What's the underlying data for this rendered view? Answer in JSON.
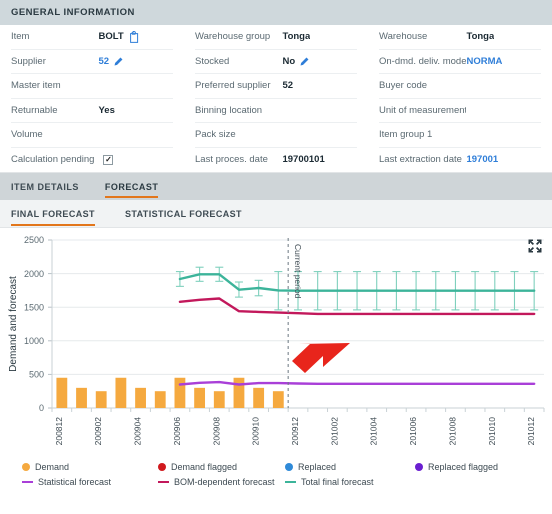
{
  "general_information": {
    "section_title": "GENERAL INFORMATION",
    "columns": [
      {
        "rows": [
          {
            "label": "Item",
            "value": "BOLT",
            "icon": "copy-icon",
            "link": false
          },
          {
            "label": "Supplier",
            "value": "52",
            "icon": "pencil-icon",
            "link": true
          },
          {
            "label": "Master item",
            "value": "",
            "icon": "",
            "link": false
          },
          {
            "label": "Returnable",
            "value": "Yes",
            "icon": "",
            "link": false
          },
          {
            "label": "Volume",
            "value": "",
            "icon": "",
            "link": false
          },
          {
            "label": "Calculation pending",
            "value": "",
            "icon": "checkbox-checked",
            "link": false
          }
        ]
      },
      {
        "rows": [
          {
            "label": "Warehouse group",
            "value": "Tonga",
            "icon": "",
            "link": false
          },
          {
            "label": "Stocked",
            "value": "No",
            "icon": "pencil-icon",
            "link": false
          },
          {
            "label": "Preferred supplier",
            "value": "52",
            "icon": "",
            "link": false
          },
          {
            "label": "Binning location",
            "value": "",
            "icon": "",
            "link": false
          },
          {
            "label": "Pack size",
            "value": "",
            "icon": "",
            "link": false
          },
          {
            "label": "Last proces. date",
            "value": "19700101",
            "icon": "",
            "link": false
          }
        ]
      },
      {
        "rows": [
          {
            "label": "Warehouse",
            "value": "Tonga",
            "icon": "",
            "link": false
          },
          {
            "label": "On-dmd. deliv. mode",
            "value": "NORMA",
            "icon": "",
            "link": true
          },
          {
            "label": "Buyer code",
            "value": "",
            "icon": "",
            "link": false
          },
          {
            "label": "Unit of measurement",
            "value": "",
            "icon": "",
            "link": false
          },
          {
            "label": "Item group 1",
            "value": "",
            "icon": "",
            "link": false
          },
          {
            "label": "Last extraction date",
            "value": "197001",
            "icon": "",
            "link": true
          }
        ]
      }
    ]
  },
  "tabs_primary": [
    {
      "label": "ITEM DETAILS",
      "active": false
    },
    {
      "label": "FORECAST",
      "active": true
    }
  ],
  "tabs_secondary": [
    {
      "label": "FINAL FORECAST",
      "active": true
    },
    {
      "label": "STATISTICAL FORECAST",
      "active": false
    }
  ],
  "chart_toolbar": {
    "expand_icon": "expand-fullscreen-icon"
  },
  "legend": {
    "row1": [
      {
        "label": "Demand",
        "marker": "dot",
        "color": "#f5a93f"
      },
      {
        "label": "Demand flagged",
        "marker": "dot",
        "color": "#d0191e"
      },
      {
        "label": "Replaced",
        "marker": "dot",
        "color": "#2f8ad8"
      },
      {
        "label": "Replaced flagged",
        "marker": "dot",
        "color": "#6a1fd0"
      }
    ],
    "row2": [
      {
        "label": "Statistical forecast",
        "marker": "dash",
        "color": "#a93fd8"
      },
      {
        "label": "BOM-dependent forecast",
        "marker": "dash",
        "color": "#c2185b"
      },
      {
        "label": "Total final forecast",
        "marker": "dash",
        "color": "#3cb49a"
      }
    ]
  },
  "annotation": {
    "arrow": "red-arrow-annotation",
    "arrow_color": "#e8251c"
  },
  "chart_data": {
    "type": "bar",
    "title": "",
    "xlabel": "",
    "ylabel": "Demand and forecast",
    "ylim": [
      0,
      2500
    ],
    "yticks": [
      0,
      500,
      1000,
      1500,
      2000,
      2500
    ],
    "grid": true,
    "legend_position": "bottom",
    "current_period_label": "Current period",
    "current_period_index": 12,
    "categories": [
      "200812",
      "200901",
      "200902",
      "200903",
      "200904",
      "200905",
      "200906",
      "200907",
      "200908",
      "200909",
      "200910",
      "200911",
      "200912",
      "201001",
      "201002",
      "201003",
      "201004",
      "201005",
      "201006",
      "201007",
      "201008",
      "201009",
      "201010",
      "201011",
      "201012"
    ],
    "xticks_labeled": [
      "200812",
      "200902",
      "200904",
      "200906",
      "200908",
      "200910",
      "200912",
      "201002",
      "201004",
      "201006",
      "201008",
      "201010",
      "201012"
    ],
    "series": [
      {
        "name": "Demand",
        "type": "bar",
        "color": "#f5a93f",
        "values": [
          450,
          300,
          250,
          450,
          300,
          250,
          450,
          300,
          250,
          450,
          300,
          250,
          null,
          null,
          null,
          null,
          null,
          null,
          null,
          null,
          null,
          null,
          null,
          null,
          null
        ]
      },
      {
        "name": "Statistical forecast",
        "type": "line",
        "color": "#a93fd8",
        "values": [
          null,
          null,
          null,
          null,
          null,
          null,
          350,
          375,
          385,
          350,
          370,
          370,
          365,
          360,
          360,
          360,
          360,
          360,
          360,
          360,
          360,
          360,
          360,
          360,
          360
        ]
      },
      {
        "name": "BOM-dependent forecast",
        "type": "line",
        "color": "#c2185b",
        "values": [
          null,
          null,
          null,
          null,
          null,
          null,
          1580,
          1610,
          1630,
          1440,
          1430,
          1420,
          1410,
          1400,
          1400,
          1400,
          1400,
          1400,
          1400,
          1400,
          1400,
          1400,
          1400,
          1400,
          1400
        ]
      },
      {
        "name": "Total final forecast",
        "type": "line",
        "color": "#3cb49a",
        "error_color": "#7fd0bd",
        "values": [
          null,
          null,
          null,
          null,
          null,
          null,
          1920,
          1990,
          1990,
          1760,
          1785,
          1750,
          1745,
          1745,
          1745,
          1745,
          1745,
          1745,
          1745,
          1745,
          1745,
          1745,
          1745,
          1745,
          1745
        ],
        "error_upper": [
          null,
          null,
          null,
          null,
          null,
          null,
          2030,
          2095,
          2095,
          1875,
          1900,
          2030,
          2030,
          2030,
          2030,
          2030,
          2030,
          2030,
          2030,
          2030,
          2030,
          2030,
          2030,
          2030,
          2030
        ],
        "error_lower": [
          null,
          null,
          null,
          null,
          null,
          null,
          1810,
          1885,
          1885,
          1650,
          1670,
          1460,
          1460,
          1460,
          1460,
          1460,
          1460,
          1460,
          1460,
          1460,
          1460,
          1460,
          1460,
          1460,
          1460
        ]
      }
    ]
  }
}
